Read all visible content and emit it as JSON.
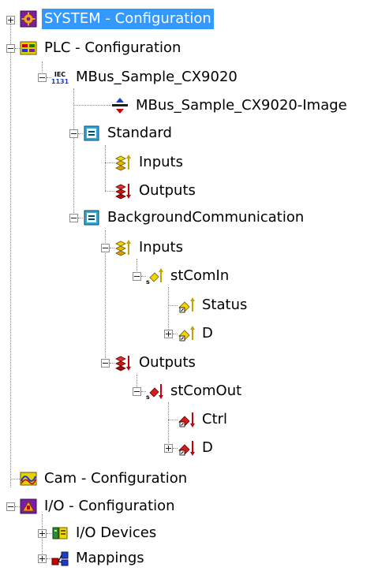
{
  "tree": {
    "system": {
      "label": "SYSTEM - Configuration",
      "selected": true
    },
    "plc": {
      "label": "PLC - Configuration",
      "project": {
        "label": "MBus_Sample_CX9020",
        "image": {
          "label": "MBus_Sample_CX9020-Image"
        },
        "standard": {
          "label": "Standard",
          "inputs": {
            "label": "Inputs"
          },
          "outputs": {
            "label": "Outputs"
          }
        },
        "background": {
          "label": "BackgroundCommunication",
          "inputs": {
            "label": "Inputs",
            "stcomin": {
              "label": "stComIn",
              "status": {
                "label": "Status"
              },
              "d": {
                "label": "D"
              }
            }
          },
          "outputs": {
            "label": "Outputs",
            "stcomout": {
              "label": "stComOut",
              "ctrl": {
                "label": "Ctrl"
              },
              "d": {
                "label": "D"
              }
            }
          }
        }
      }
    },
    "cam": {
      "label": "Cam - Configuration"
    },
    "io": {
      "label": "I/O - Configuration",
      "devices": {
        "label": "I/O Devices"
      },
      "mappings": {
        "label": "Mappings"
      }
    }
  },
  "colors": {
    "selection": "#3399ff",
    "input_arrow": "#c8a000",
    "output_arrow": "#cc0000"
  }
}
